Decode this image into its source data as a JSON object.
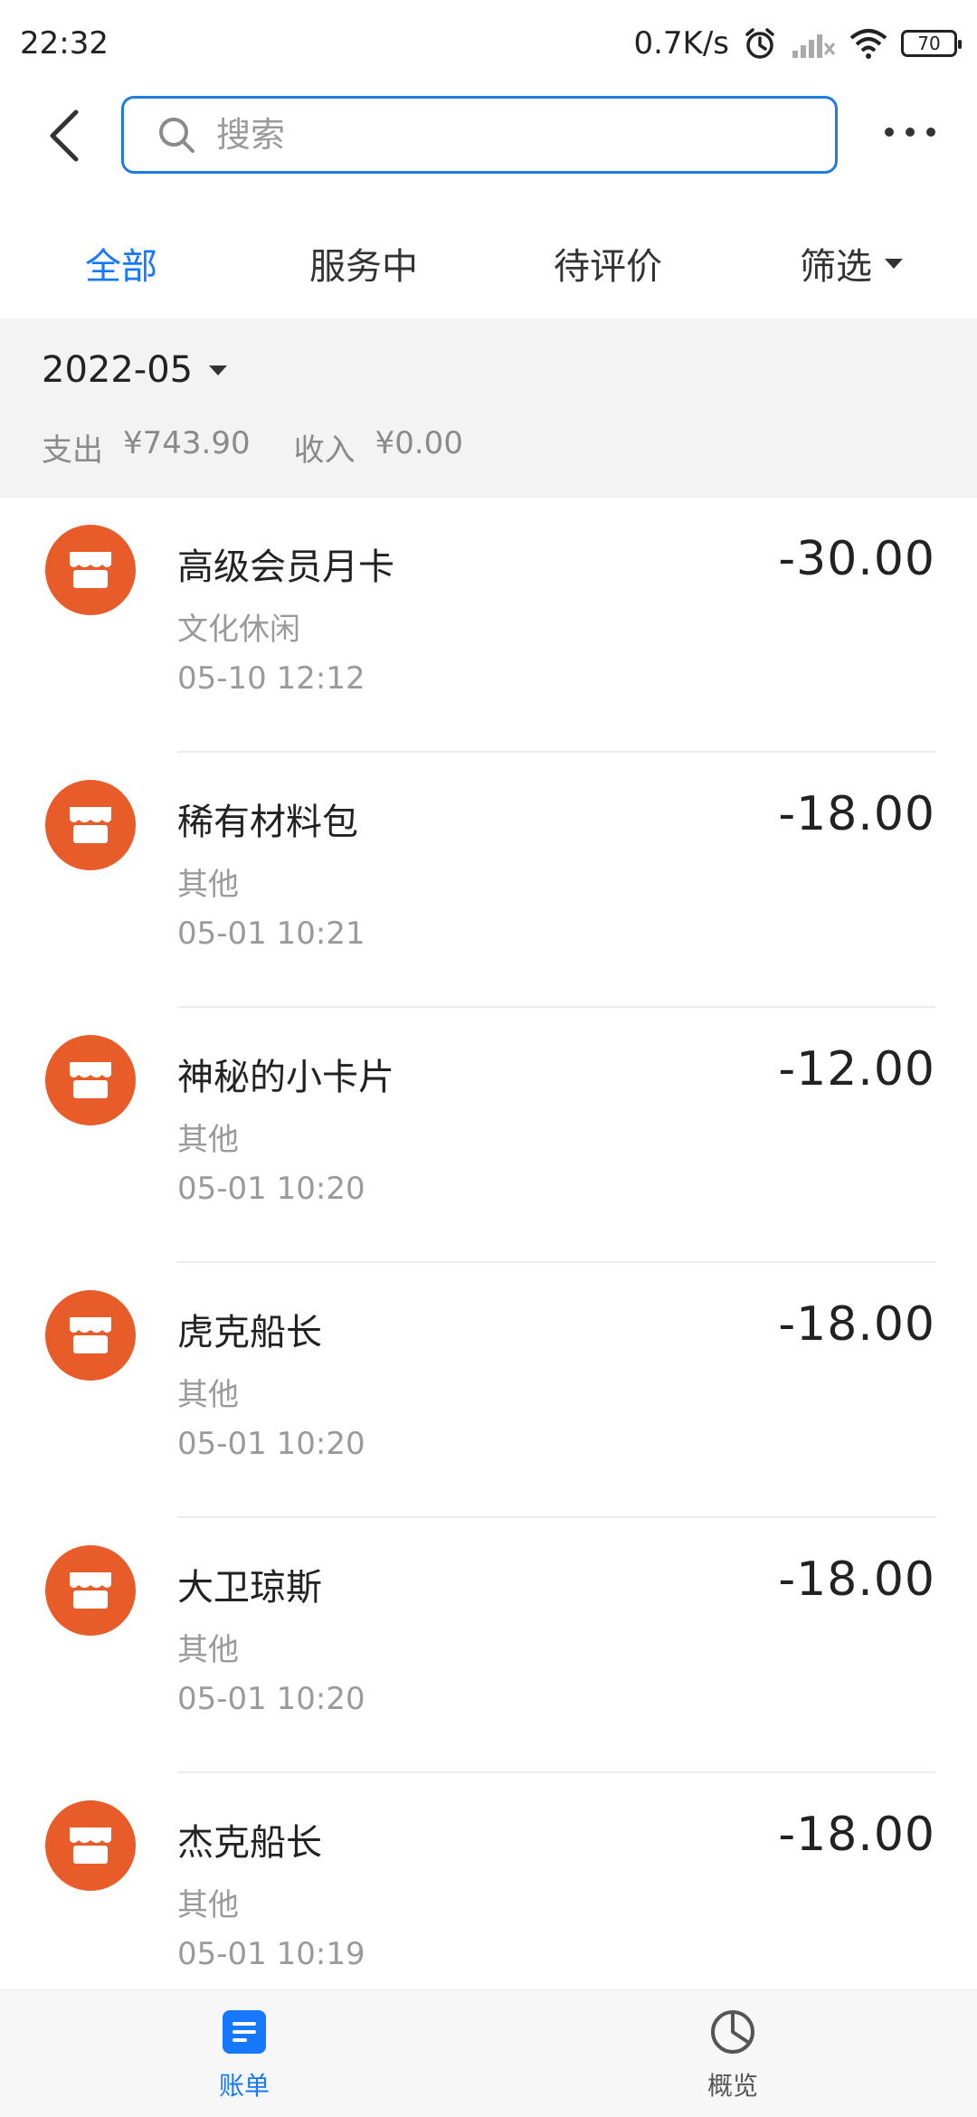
{
  "status_bar": {
    "time": "22:32",
    "net_speed": "0.7K/s",
    "battery": "70"
  },
  "header": {
    "search_placeholder": "搜索"
  },
  "tabs": [
    {
      "label": "全部",
      "active": true
    },
    {
      "label": "服务中",
      "active": false
    },
    {
      "label": "待评价",
      "active": false
    },
    {
      "label": "筛选",
      "active": false
    }
  ],
  "summary": {
    "month": "2022-05",
    "expense_label": "支出",
    "expense_value": "¥743.90",
    "income_label": "收入",
    "income_value": "¥0.00"
  },
  "transactions": [
    {
      "title": "高级会员月卡",
      "category": "文化休闲",
      "time": "05-10  12:12",
      "amount": "-30.00"
    },
    {
      "title": "稀有材料包",
      "category": "其他",
      "time": "05-01  10:21",
      "amount": "-18.00"
    },
    {
      "title": "神秘的小卡片",
      "category": "其他",
      "time": "05-01  10:20",
      "amount": "-12.00"
    },
    {
      "title": "虎克船长",
      "category": "其他",
      "time": "05-01  10:20",
      "amount": "-18.00"
    },
    {
      "title": "大卫琼斯",
      "category": "其他",
      "time": "05-01  10:20",
      "amount": "-18.00"
    },
    {
      "title": "杰克船长",
      "category": "其他",
      "time": "05-01  10:19",
      "amount": "-18.00"
    }
  ],
  "bottom_nav": [
    {
      "label": "账单",
      "icon": "bill-icon",
      "active": true
    },
    {
      "label": "概览",
      "icon": "pie-chart-icon",
      "active": false
    }
  ],
  "colors": {
    "accent": "#1677ff",
    "merchant_icon": "#e85c2a"
  }
}
